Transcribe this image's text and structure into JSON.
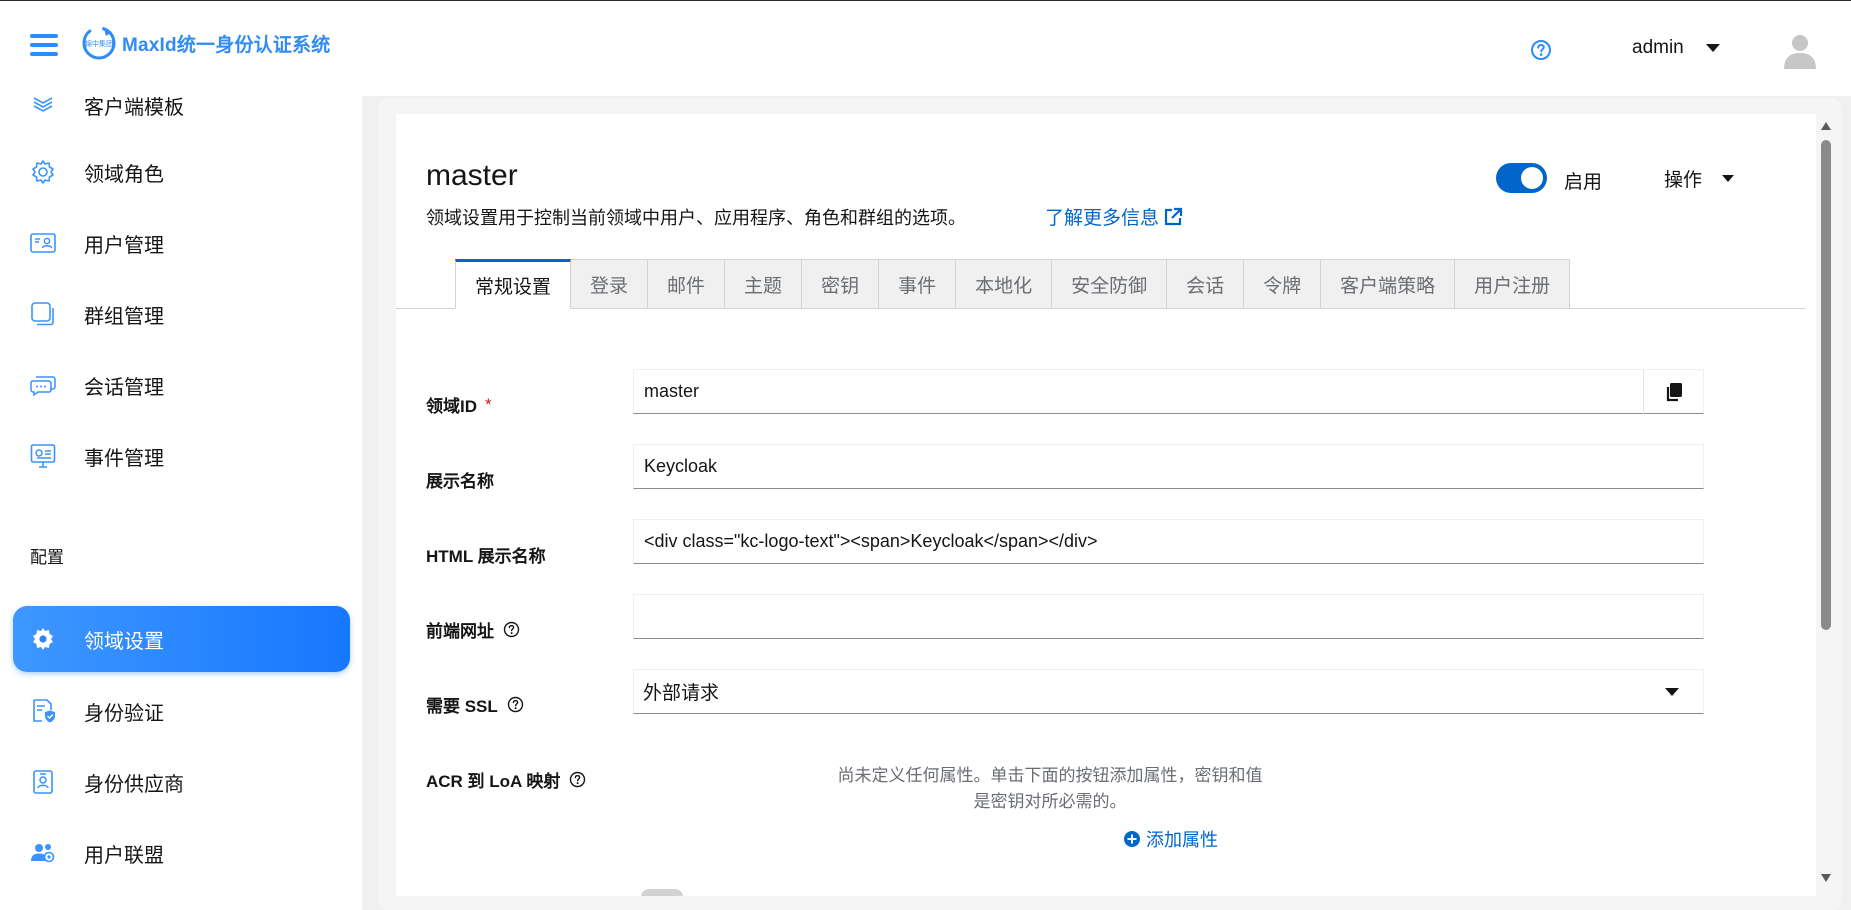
{
  "header": {
    "logo_text": "MaxId统一身份认证系统",
    "logo_mark_text": "锦中集团",
    "user_name": "admin"
  },
  "sidebar": {
    "items": [
      {
        "label": "客户端模板",
        "icon": "layers-icon"
      },
      {
        "label": "领域角色",
        "icon": "gear-icon"
      },
      {
        "label": "用户管理",
        "icon": "id-card-icon"
      },
      {
        "label": "群组管理",
        "icon": "stacked-squares-icon"
      },
      {
        "label": "会话管理",
        "icon": "chat-icon"
      },
      {
        "label": "事件管理",
        "icon": "monitor-icon"
      }
    ],
    "section_title": "配置",
    "config_items": [
      {
        "label": "领域设置",
        "icon": "gear-icon",
        "active": true
      },
      {
        "label": "身份验证",
        "icon": "lock-doc-icon"
      },
      {
        "label": "身份供应商",
        "icon": "user-badge-icon"
      },
      {
        "label": "用户联盟",
        "icon": "users-icon"
      }
    ]
  },
  "page": {
    "title": "master",
    "description": "领域设置用于控制当前领域中用户、应用程序、角色和群组的选项。",
    "learn_more": "了解更多信息",
    "enabled_label": "启用",
    "enabled": true,
    "actions_label": "操作"
  },
  "tabs": [
    "常规设置",
    "登录",
    "邮件",
    "主题",
    "密钥",
    "事件",
    "本地化",
    "安全防御",
    "会话",
    "令牌",
    "客户端策略",
    "用户注册"
  ],
  "form": {
    "realm_id_label": "领域ID",
    "realm_id_required": "*",
    "realm_id_value": "master",
    "display_name_label": "展示名称",
    "display_name_value": "Keycloak",
    "html_display_name_label": "HTML 展示名称",
    "html_display_name_value": "<div class=\"kc-logo-text\"><span>Keycloak</span></div>",
    "frontend_url_label": "前端网址",
    "frontend_url_value": "",
    "ssl_label": "需要 SSL",
    "ssl_value": "外部请求",
    "acr_label": "ACR 到 LoA 映射",
    "acr_empty_line1": "尚未定义任何属性。单击下面的按钮添加属性，密钥和值",
    "acr_empty_line2": "是密钥对所必需的。",
    "add_attribute": "添加属性"
  },
  "colors": {
    "accent": "#0066cc",
    "brand": "#2f8cf5",
    "active_nav": "#1677ff",
    "required": "#c9190b"
  }
}
